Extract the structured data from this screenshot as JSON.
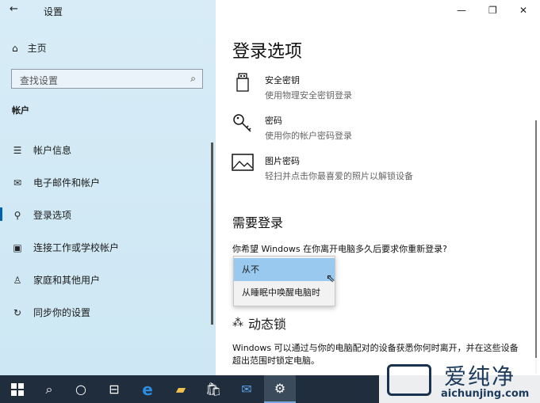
{
  "app": {
    "title": "设置"
  },
  "nav": {
    "home": "主页",
    "search_placeholder": "查找设置",
    "section": "帐户",
    "items": [
      {
        "label": "帐户信息"
      },
      {
        "label": "电子邮件和帐户"
      },
      {
        "label": "登录选项"
      },
      {
        "label": "连接工作或学校帐户"
      },
      {
        "label": "家庭和其他用户"
      },
      {
        "label": "同步你的设置"
      }
    ],
    "selected_index": 2
  },
  "page": {
    "title": "登录选项",
    "options": [
      {
        "name": "安全密钥",
        "desc": "使用物理安全密钥登录"
      },
      {
        "name": "密码",
        "desc": "使用你的帐户密码登录"
      },
      {
        "name": "图片密码",
        "desc": "轻扫并点击你最喜爱的照片以解锁设备"
      }
    ],
    "require_signin": {
      "heading": "需要登录",
      "question": "你希望 Windows 在你离开电脑多久后要求你重新登录?",
      "dropdown_options": [
        "从不",
        "从睡眠中唤醒电脑时"
      ],
      "selected": "从不"
    },
    "dynamic_lock": {
      "heading": "动态锁",
      "desc": "Windows 可以通过与你的电脑配对的设备获悉你何时离开，并在这些设备超出范围时锁定电脑。"
    }
  },
  "watermark": {
    "cn": "爱纯净",
    "url": "aichunjing.com"
  },
  "colors": {
    "accent": "#0063b1",
    "selection": "#99c9ef",
    "taskbar": "#1f2d3c"
  }
}
